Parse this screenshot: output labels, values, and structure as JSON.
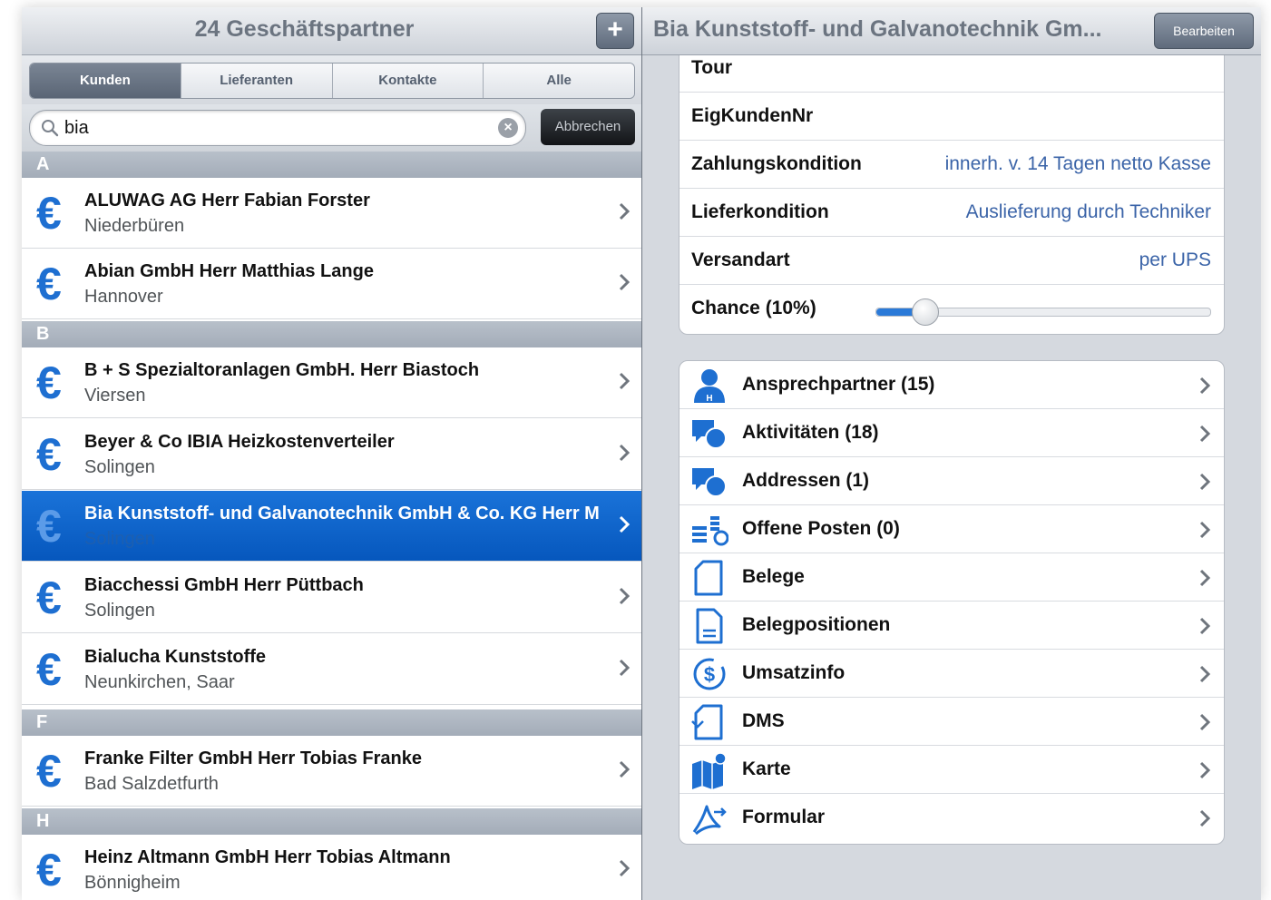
{
  "left": {
    "title": "24 Geschäftspartner",
    "add_label": "+",
    "segments": [
      "Kunden",
      "Lieferanten",
      "Kontakte",
      "Alle"
    ],
    "search": {
      "value": "bia",
      "cancel_label": "Abbrechen"
    },
    "sections": {
      "A": "A",
      "B": "B",
      "F": "F",
      "H": "H"
    },
    "rows": [
      {
        "name": "ALUWAG AG  Herr Fabian Forster",
        "city": "Niederbüren"
      },
      {
        "name": "Abian GmbH  Herr Matthias Lange",
        "city": "Hannover"
      },
      {
        "name": "B + S Spezialtoranlagen GmbH.  Herr Biastoch",
        "city": "Viersen"
      },
      {
        "name": "Beyer & Co IBIA Heizkostenverteiler",
        "city": "Solingen"
      },
      {
        "name": "Bia Kunststoff- und Galvanotechnik  GmbH & Co. KG Herr M",
        "city": "Solingen"
      },
      {
        "name": "Biacchessi GmbH  Herr Püttbach",
        "city": "Solingen"
      },
      {
        "name": "Bialucha Kunststoffe",
        "city": "Neunkirchen, Saar"
      },
      {
        "name": "Franke Filter GmbH  Herr Tobias Franke",
        "city": "Bad Salzdetfurth"
      },
      {
        "name": "Heinz Altmann GmbH  Herr Tobias Altmann",
        "city": "Bönnigheim"
      }
    ],
    "row_icon": "euro-icon",
    "selected_row": 4
  },
  "right": {
    "title": "Bia Kunststoff- und Galvanotechnik  Gm...",
    "edit_label": "Bearbeiten",
    "details": [
      {
        "label": "Tour",
        "value": ""
      },
      {
        "label": "EigKundenNr",
        "value": ""
      },
      {
        "label": "Zahlungskondition",
        "value": "innerh. v. 14 Tagen netto Kasse"
      },
      {
        "label": "Lieferkondition",
        "value": "Auslieferung durch Techniker"
      },
      {
        "label": "Versandart",
        "value": "per UPS"
      }
    ],
    "chance": {
      "label": "Chance (10%)",
      "value": 0.1
    },
    "links": [
      {
        "label": "Ansprechpartner (15)",
        "icon": "person-icon"
      },
      {
        "label": "Aktivitäten (18)",
        "icon": "chat-bubbles-icon"
      },
      {
        "label": "Addressen (1)",
        "icon": "chat-bubbles-icon"
      },
      {
        "label": "Offene Posten (0)",
        "icon": "open-items-icon"
      },
      {
        "label": "Belege",
        "icon": "document-icon"
      },
      {
        "label": "Belegpositionen",
        "icon": "document-lines-icon"
      },
      {
        "label": "Umsatzinfo",
        "icon": "revenue-icon"
      },
      {
        "label": "DMS",
        "icon": "dms-icon"
      },
      {
        "label": "Karte",
        "icon": "map-icon"
      },
      {
        "label": "Formular",
        "icon": "form-icon"
      }
    ]
  },
  "colors": {
    "accent": "#1e6fd1",
    "selection": "#0a5fc4",
    "value_text": "#3b64a8"
  }
}
